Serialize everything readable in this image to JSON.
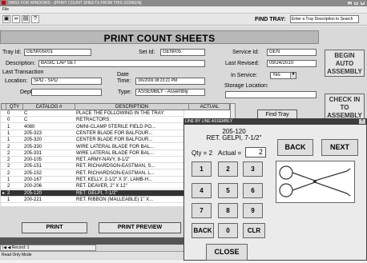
{
  "window": {
    "title": "DMS2 FOR WINDOWS - [PRINT COUNT SHEETS FROM THIS SCREEN]",
    "menu": "File"
  },
  "toolbar": {
    "find_label": "FIND TRAY:",
    "find_placeholder": "Enter a Tray Description to Search"
  },
  "header": {
    "title": "PRINT COUNT SHEETS"
  },
  "form": {
    "tray_id_label": "Tray Id:",
    "tray_id": "GEN005001",
    "set_id_label": "Set Id:",
    "set_id": "GEN005",
    "service_id_label": "Service Id:",
    "service_id": "GEN",
    "description_label": "Description:",
    "description": "BASIC LAP SET",
    "last_revised_label": "Last Revised:",
    "last_revised": "09/24/2010",
    "last_transaction_label": "Last Transaction",
    "date_label": "Date",
    "location_label": "Location:",
    "location": "SPD - SPD",
    "time_label": "Time:",
    "time": "3/6/2009 08:23:21 PM",
    "in_service_label": "In Service:",
    "in_service": "Yes",
    "dept_label": "Dept:",
    "dept": "",
    "type_label": "Type:",
    "type": "ASSEMBLY - Assembly",
    "storage_label": "Storage Location:",
    "storage": ""
  },
  "side_buttons": {
    "begin": "BEGIN AUTO ASSEMBLY",
    "checkin": "CHECK IN TO ASSEMBLY"
  },
  "table": {
    "headers": [
      "QTY",
      "CATALOG #",
      "DESCRIPTION",
      "ACTUAL"
    ],
    "rows": [
      {
        "qty": "0",
        "cat": "C",
        "desc": "PLACE THE FOLLOWING IN THE TRAY:",
        "actual": "",
        "sel": false
      },
      {
        "qty": "0",
        "cat": "C",
        "desc": "RETRACTORS:",
        "actual": "",
        "sel": false
      },
      {
        "qty": "1",
        "cat": "4080",
        "desc": "OMNI-CLAMP STERILE FIELD PO...",
        "actual": "",
        "sel": false
      },
      {
        "qty": "1",
        "cat": "205-323",
        "desc": "CENTER BLADE FOR BALFOUR...",
        "actual": "",
        "sel": false
      },
      {
        "qty": "1",
        "cat": "205-320",
        "desc": "CENTER BLADE FOR BALFOUR...",
        "actual": "",
        "sel": false
      },
      {
        "qty": "2",
        "cat": "205-330",
        "desc": "WIRE LATERAL BLADE FOR BAL...",
        "actual": "",
        "sel": false
      },
      {
        "qty": "2",
        "cat": "205-331",
        "desc": "WIRE LATERAL BLADE FOR BAL...",
        "actual": "",
        "sel": false
      },
      {
        "qty": "2",
        "cat": "200-105",
        "desc": "RET. ARMY-NAVY, 8-1/2\"",
        "actual": "",
        "sel": false
      },
      {
        "qty": "2",
        "cat": "205-151",
        "desc": "RET. RICHARDSON-EASTMAN, S...",
        "actual": "",
        "sel": false
      },
      {
        "qty": "2",
        "cat": "205-152",
        "desc": "RET. RICHARDSON-EASTMAN, L...",
        "actual": "",
        "sel": false
      },
      {
        "qty": "1",
        "cat": "200-167",
        "desc": "RET. KELLY, 2-1/2\" X 3\", LAMB-H...",
        "actual": "",
        "sel": false
      },
      {
        "qty": "2",
        "cat": "200-206",
        "desc": "RET. DEAVER, 2\" X 12\"",
        "actual": "",
        "sel": false
      },
      {
        "qty": "2",
        "cat": "205-120",
        "desc": "RET. GELPI, 7-1/2\"",
        "actual": "",
        "sel": true
      },
      {
        "qty": "1",
        "cat": "200-221",
        "desc": "RET. RIBBON (MALLEABLE) 1\" X...",
        "actual": "",
        "sel": false
      }
    ]
  },
  "buttons": {
    "print": "PRINT",
    "preview": "PRINT PREVIEW",
    "find_tray": "Find Tray"
  },
  "navigation": {
    "record": "Record: 1"
  },
  "status": "Read Only Mode",
  "popup": {
    "title": "LINE BY LINE ASSEMBLY",
    "catalog": "205-120",
    "description": "RET. GELPI, 7-1/2\"",
    "qty_label": "Qty = 2",
    "actual_label": "Actual =",
    "actual": "2",
    "back": "BACK",
    "next": "NEXT",
    "keys": [
      "1",
      "2",
      "3",
      "4",
      "5",
      "6",
      "7",
      "8",
      "9",
      "BACK",
      "0",
      "CLR"
    ],
    "close": "CLOSE"
  },
  "colors": {
    "header_band": "#b8b8b8",
    "selected_row": "#333333"
  }
}
